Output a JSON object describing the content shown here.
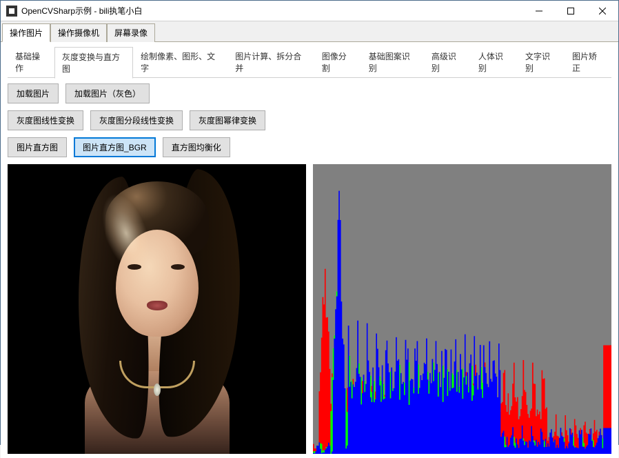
{
  "window": {
    "title": "OpenCVSharp示例 - bili执笔小白"
  },
  "main_tabs": [
    {
      "label": "操作图片",
      "active": true
    },
    {
      "label": "操作摄像机",
      "active": false
    },
    {
      "label": "屏幕录像",
      "active": false
    }
  ],
  "sub_tabs": [
    {
      "label": "基础操作",
      "active": false
    },
    {
      "label": "灰度变换与直方图",
      "active": true
    },
    {
      "label": "绘制像素、图形、文字",
      "active": false
    },
    {
      "label": "图片计算、拆分合并",
      "active": false
    },
    {
      "label": "图像分割",
      "active": false
    },
    {
      "label": "基础图案识别",
      "active": false
    },
    {
      "label": "高级识别",
      "active": false
    },
    {
      "label": "人体识别",
      "active": false
    },
    {
      "label": "文字识别",
      "active": false
    },
    {
      "label": "图片矫正",
      "active": false
    }
  ],
  "button_rows": {
    "row1": [
      {
        "label": "加载图片",
        "selected": false
      },
      {
        "label": "加载图片（灰色）",
        "selected": false
      }
    ],
    "row2": [
      {
        "label": "灰度图线性变换",
        "selected": false
      },
      {
        "label": "灰度图分段线性变换",
        "selected": false
      },
      {
        "label": "灰度图幂律变换",
        "selected": false
      }
    ],
    "row3": [
      {
        "label": "图片直方图",
        "selected": false
      },
      {
        "label": "图片直方图_BGR",
        "selected": true
      },
      {
        "label": "直方图均衡化",
        "selected": false
      }
    ]
  },
  "chart_data": {
    "type": "histogram_bgr",
    "note": "BGR color histogram of loaded image; values are approximate relative heights (0-400) per intensity bin 0-255",
    "bins": 256,
    "channels": {
      "blue": {
        "color": "#0000FF",
        "peak_bin": 22,
        "peak_height": 400,
        "secondary_region": [
          30,
          160
        ],
        "secondary_avg": 140,
        "tail_region": [
          160,
          255
        ],
        "tail_avg": 25
      },
      "green": {
        "color": "#00FF00",
        "peak_bin": 20,
        "peak_height": 280,
        "secondary_region": [
          25,
          150
        ],
        "secondary_avg": 110,
        "tail_region": [
          150,
          255
        ],
        "tail_avg": 15
      },
      "red": {
        "color": "#FF0000",
        "peak_bin": 10,
        "peak_height": 320,
        "secondary_region": [
          15,
          200
        ],
        "secondary_avg": 100,
        "tail_region": [
          200,
          255
        ],
        "tail_avg": 35
      }
    }
  }
}
